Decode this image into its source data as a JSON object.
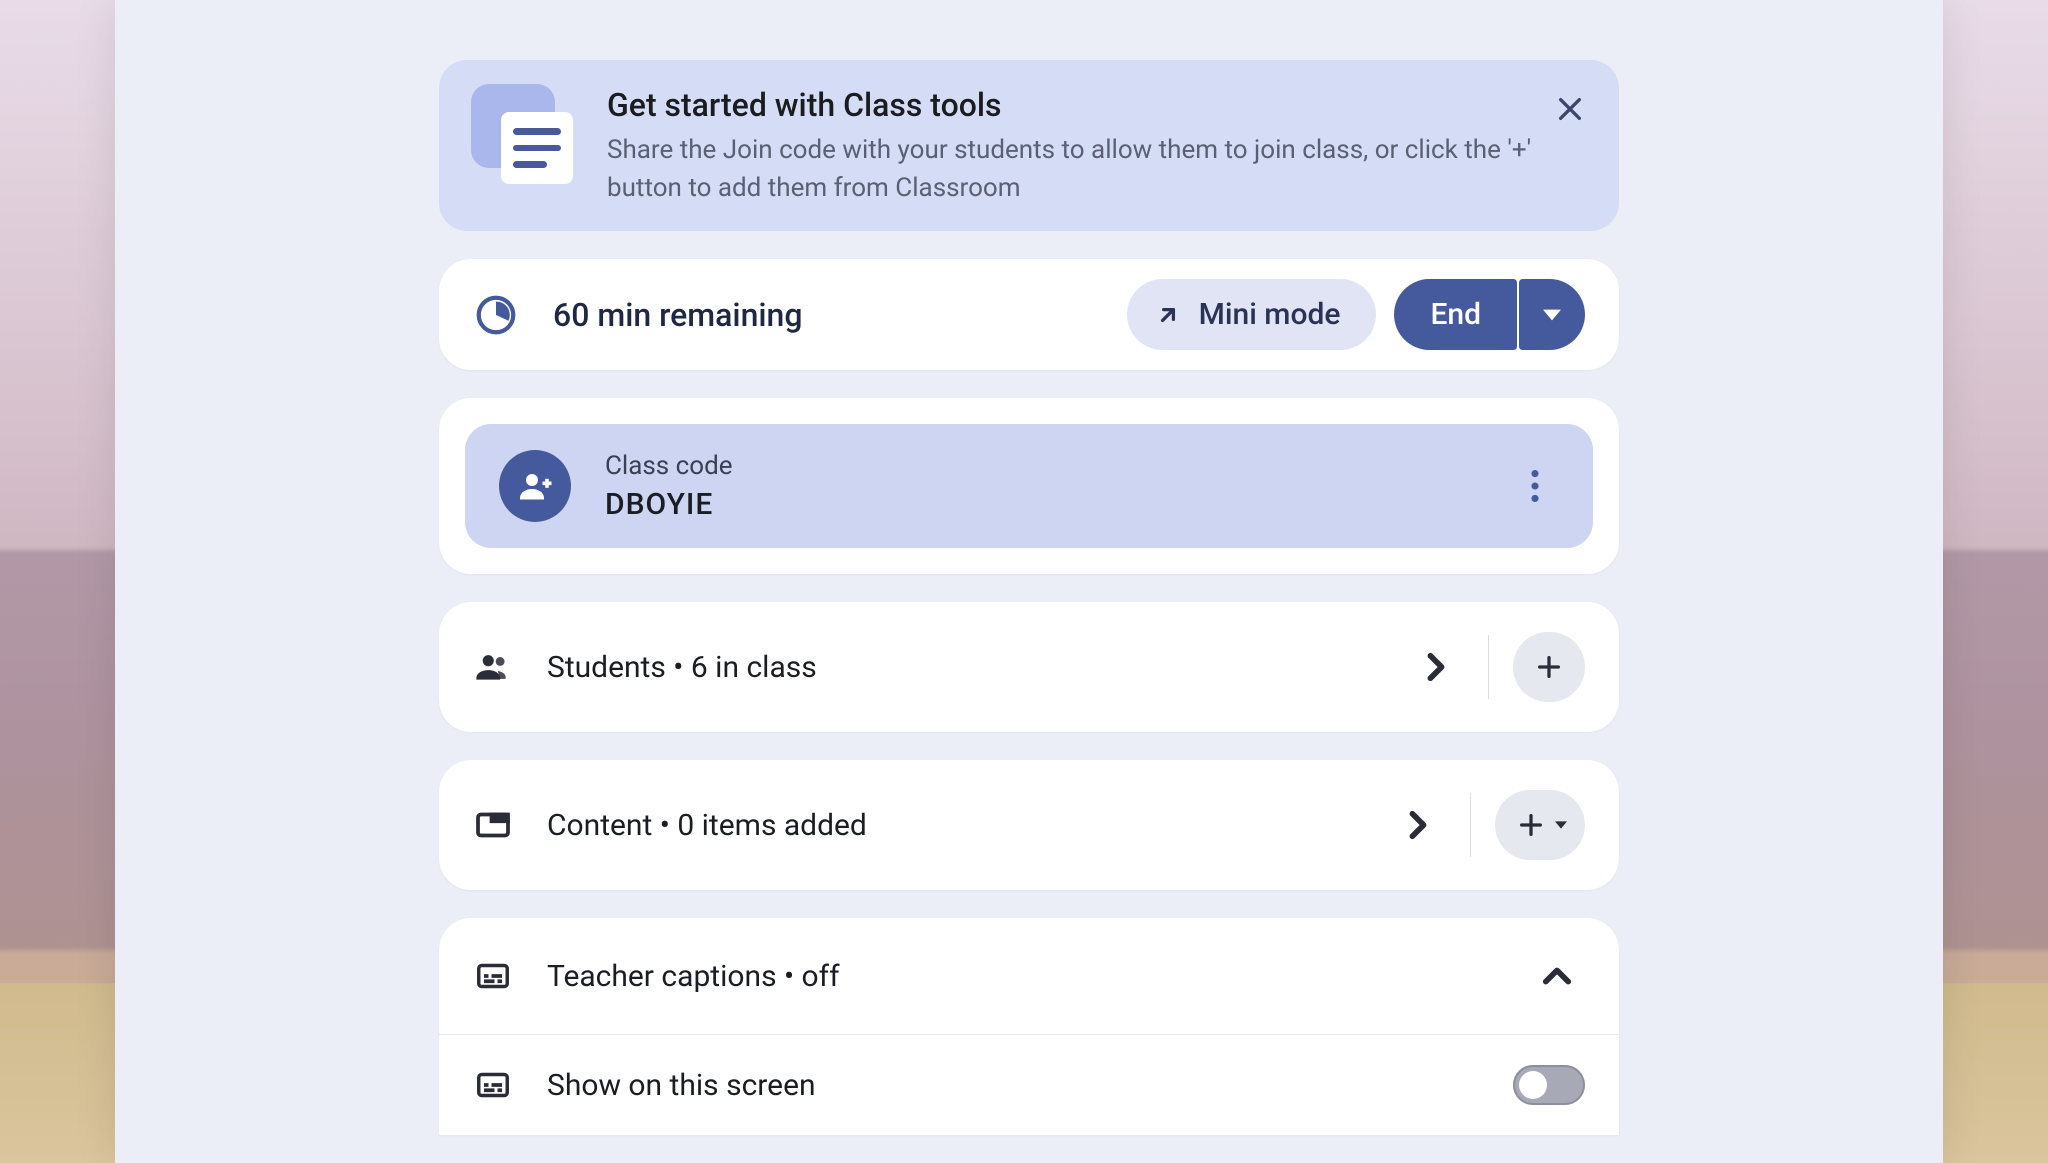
{
  "banner": {
    "title": "Get started with Class tools",
    "description": "Share the Join code with your students to allow them to join class, or click the '+' button to add them from Classroom"
  },
  "status": {
    "time_remaining": "60 min remaining",
    "mini_mode_label": "Mini mode",
    "end_label": "End"
  },
  "class_code": {
    "label": "Class code",
    "value": "DBOYIE"
  },
  "students": {
    "label": "Students • 6 in class"
  },
  "content_row": {
    "label": "Content • 0 items added"
  },
  "captions": {
    "header_label": "Teacher captions • off",
    "show_label": "Show on this screen",
    "show_on": false
  },
  "colors": {
    "accent": "#455a9c",
    "banner_bg": "#d5dcf6",
    "code_bg": "#cdd5f2",
    "panel_bg": "#eceef7"
  }
}
